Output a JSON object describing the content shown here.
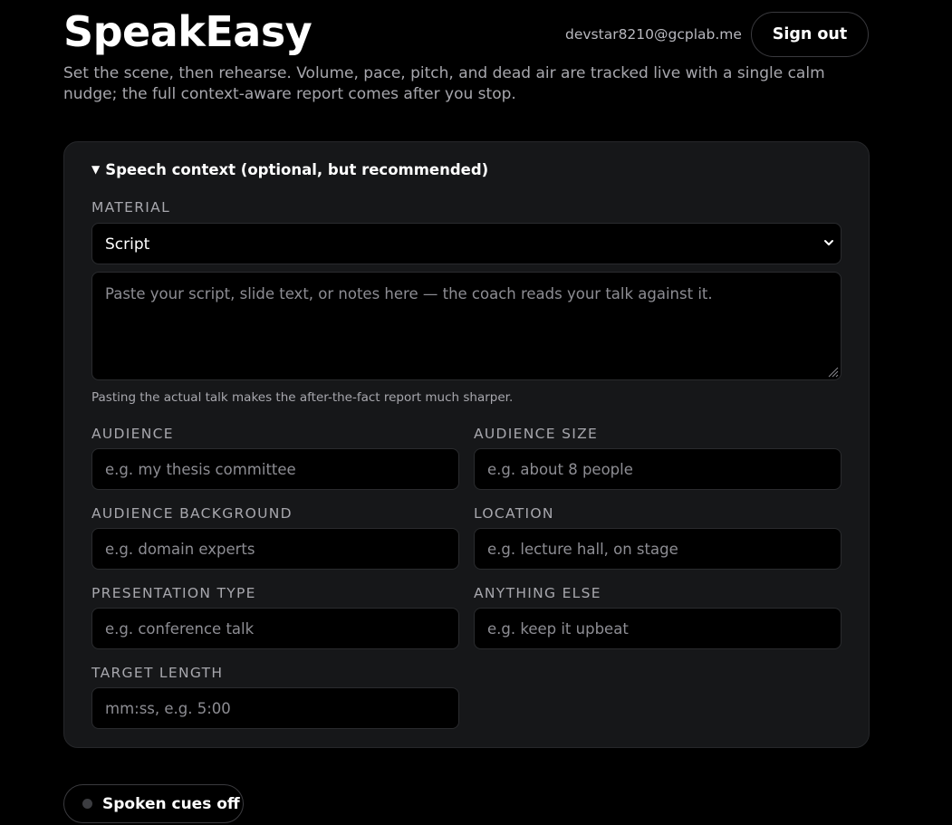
{
  "header": {
    "app_title": "SpeakEasy",
    "user_email": "devstar8210@gcplab.me",
    "sign_out_label": "Sign out",
    "subtitle": "Set the scene, then rehearse. Volume, pace, pitch, and dead air are tracked live with a single calm nudge; the full context-aware report comes after you stop."
  },
  "context_panel": {
    "summary_label": "Speech context (optional, but recommended)",
    "expanded": true,
    "material": {
      "label": "MATERIAL",
      "selected": "Script",
      "textarea_placeholder": "Paste your script, slide text, or notes here — the coach reads your talk against it.",
      "hint": "Pasting the actual talk makes the after-the-fact report much sharper."
    },
    "fields": {
      "audience": {
        "label": "AUDIENCE",
        "placeholder": "e.g. my thesis committee"
      },
      "audience_size": {
        "label": "AUDIENCE SIZE",
        "placeholder": "e.g. about 8 people"
      },
      "audience_background": {
        "label": "AUDIENCE BACKGROUND",
        "placeholder": "e.g. domain experts"
      },
      "location": {
        "label": "LOCATION",
        "placeholder": "e.g. lecture hall, on stage"
      },
      "presentation_type": {
        "label": "PRESENTATION TYPE",
        "placeholder": "e.g. conference talk"
      },
      "anything_else": {
        "label": "ANYTHING ELSE",
        "placeholder": "e.g. keep it upbeat"
      },
      "target_length": {
        "label": "TARGET LENGTH",
        "placeholder": "mm:ss, e.g. 5:00"
      }
    }
  },
  "spoken_cues": {
    "label": "Spoken cues off",
    "enabled": false
  },
  "colors": {
    "background": "#000000",
    "panel": "#161719",
    "input_background": "#000000",
    "muted_text": "#a7a7ad",
    "placeholder_text": "#8d8d93"
  },
  "icons": {
    "select_chevron": "chevron-down-icon",
    "summary_caret": "caret-down-icon",
    "resize_handle": "resize-grip-icon",
    "cues_status": "status-dot-icon"
  }
}
